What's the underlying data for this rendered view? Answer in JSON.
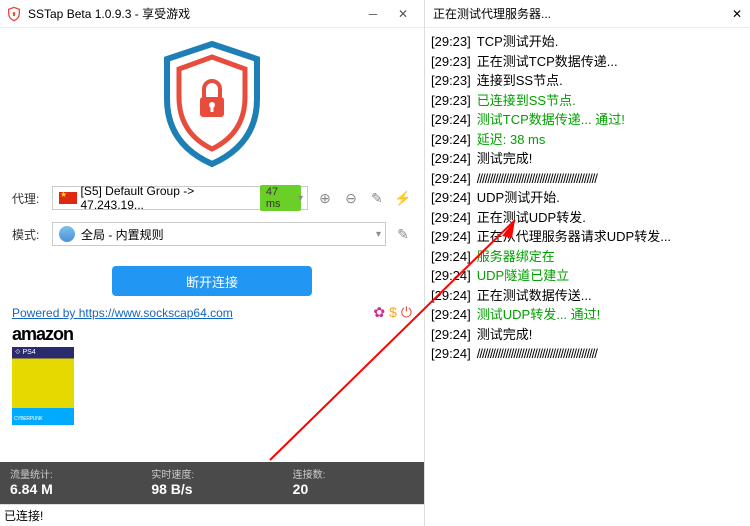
{
  "titlebar": {
    "title": "SSTap Beta 1.0.9.3 - 享受游戏"
  },
  "proxy": {
    "label": "代理:",
    "value": "[S5] Default Group -> 47.243.19...",
    "latency": "47 ms"
  },
  "mode": {
    "label": "模式:",
    "value": "全局 - 内置规则"
  },
  "disconnect_label": "断开连接",
  "powered_text": "Powered by https://www.sockscap64.com",
  "ad": {
    "brand": "amazon"
  },
  "stats": {
    "traffic_label": "流量统计:",
    "traffic_value": "6.84 M",
    "speed_label": "实时速度:",
    "speed_value": "98 B/s",
    "conn_label": "连接数:",
    "conn_value": "20"
  },
  "status_text": "已连接!",
  "log_title": "正在测试代理服务器...",
  "log": [
    {
      "ts": "[29:23]",
      "msg": "TCP测试开始.",
      "cls": ""
    },
    {
      "ts": "[29:23]",
      "msg": "正在测试TCP数据传递...",
      "cls": ""
    },
    {
      "ts": "[29:23]",
      "msg": "连接到SS节点.",
      "cls": ""
    },
    {
      "ts": "[29:23]",
      "msg": "已连接到SS节点.",
      "cls": "green"
    },
    {
      "ts": "[29:24]",
      "msg": "测试TCP数据传递... 通过!",
      "cls": "green"
    },
    {
      "ts": "[29:24]",
      "msg": "延迟: 38 ms",
      "cls": "green"
    },
    {
      "ts": "[29:24]",
      "msg": "测试完成!",
      "cls": ""
    },
    {
      "ts": "[29:24]",
      "msg": "//////////////////////////////////////////////",
      "cls": "",
      "sep": true
    },
    {
      "ts": "[29:24]",
      "msg": "UDP测试开始.",
      "cls": ""
    },
    {
      "ts": "[29:24]",
      "msg": "正在测试UDP转发.",
      "cls": ""
    },
    {
      "ts": "[29:24]",
      "msg": "正在从代理服务器请求UDP转发...",
      "cls": ""
    },
    {
      "ts": "[29:24]",
      "msg": "服务器绑定在",
      "cls": "green"
    },
    {
      "ts": "",
      "msg": "",
      "cls": ""
    },
    {
      "ts": "[29:24]",
      "msg": "UDP隧道已建立",
      "cls": "green"
    },
    {
      "ts": "[29:24]",
      "msg": "正在测试数据传送...",
      "cls": ""
    },
    {
      "ts": "[29:24]",
      "msg": "测试UDP转发... 通过!",
      "cls": "green"
    },
    {
      "ts": "[29:24]",
      "msg": "测试完成!",
      "cls": ""
    },
    {
      "ts": "[29:24]",
      "msg": "//////////////////////////////////////////////",
      "cls": "",
      "sep": true
    }
  ]
}
